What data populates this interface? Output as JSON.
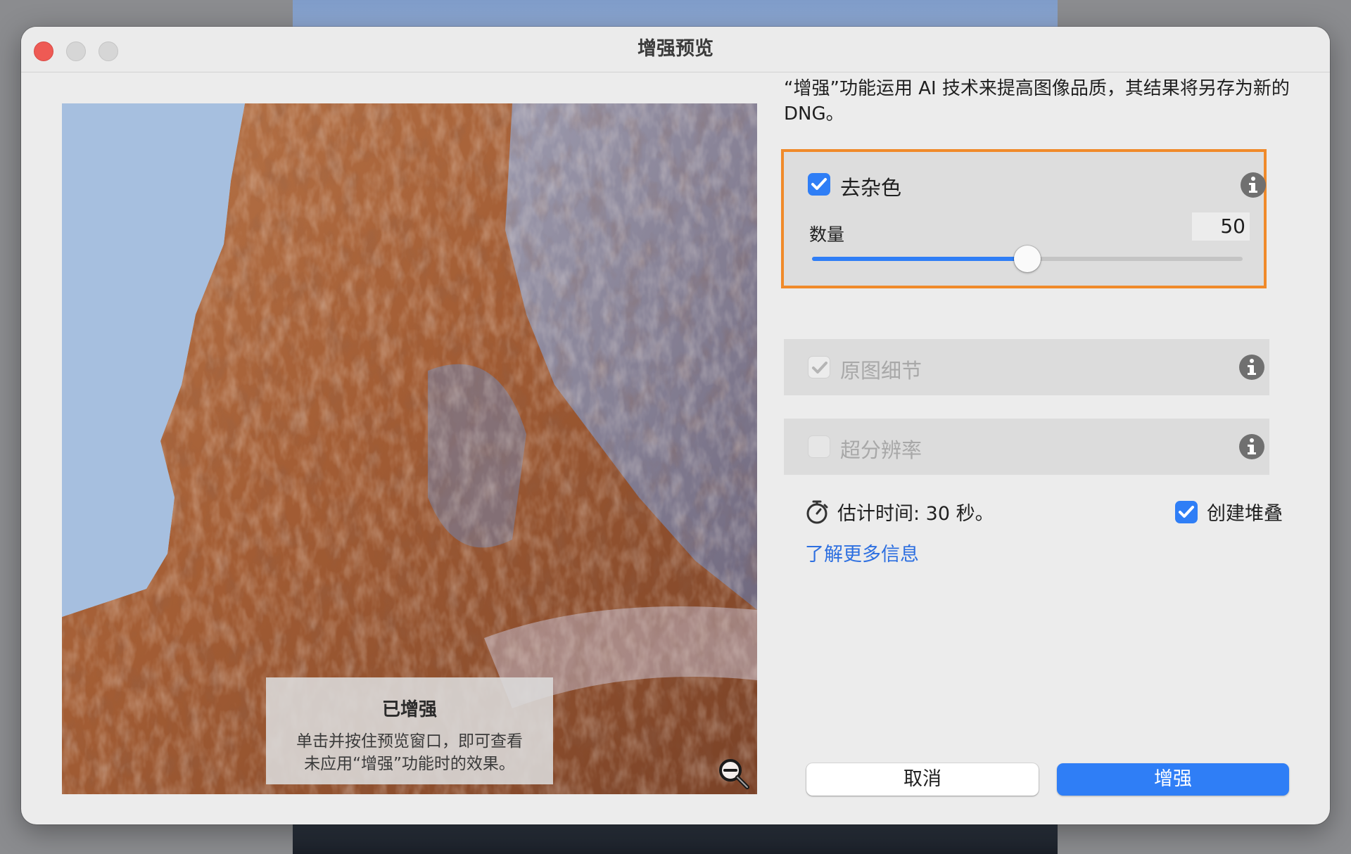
{
  "window": {
    "title": "增强预览"
  },
  "preview": {
    "overlay_title": "已增强",
    "overlay_text_line1": "单击并按住预览窗口，即可查看",
    "overlay_text_line2": "未应用“增强”功能时的效果。",
    "zoom_icon": "zoom-out-icon"
  },
  "description": "“增强”功能运用 AI 技术来提高图像品质，其结果将另存为新的 DNG。",
  "options": {
    "denoise": {
      "label": "去杂色",
      "checked": true,
      "amount_label": "数量",
      "amount_value": "50",
      "slider_fraction": 0.5
    },
    "raw_details": {
      "label": "原图细节",
      "checked": true,
      "disabled": true
    },
    "super_resolution": {
      "label": "超分辨率",
      "checked": false,
      "disabled": true
    }
  },
  "estimate": {
    "text": "估计时间: 30 秒。",
    "icon": "stopwatch-icon"
  },
  "create_stack": {
    "label": "创建堆叠",
    "checked": true
  },
  "learn_more": "了解更多信息",
  "buttons": {
    "cancel": "取消",
    "enhance": "增强"
  },
  "colors": {
    "accent": "#2f7ef6",
    "highlight_border": "#f08a2a",
    "link": "#2d6fe0"
  }
}
